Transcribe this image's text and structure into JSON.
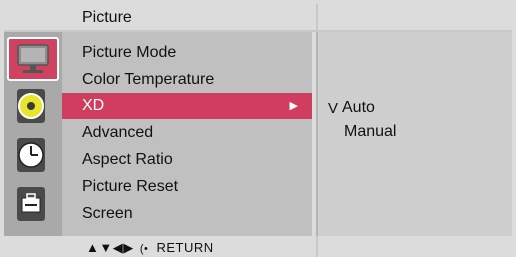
{
  "header": {
    "title": "Picture"
  },
  "sidebar": {
    "icons": [
      {
        "name": "picture-icon",
        "active": true
      },
      {
        "name": "audio-icon",
        "active": false
      },
      {
        "name": "time-icon",
        "active": false
      },
      {
        "name": "option-icon",
        "active": false
      }
    ]
  },
  "menu": {
    "items": [
      {
        "label": "Picture Mode"
      },
      {
        "label": "Color Temperature"
      },
      {
        "label": "XD",
        "selected": true,
        "arrow": "▶"
      },
      {
        "label": "Advanced"
      },
      {
        "label": "Aspect Ratio"
      },
      {
        "label": "Picture Reset"
      },
      {
        "label": "Screen"
      }
    ]
  },
  "submenu": {
    "check_mark": "V",
    "options": [
      "Auto",
      "Manual"
    ],
    "selected": "Auto"
  },
  "footer": {
    "nav_symbols": "▲▼◀▶",
    "enter_symbol": "(•",
    "return_label": "RETURN"
  },
  "colors": {
    "selected": "#cf3e5e",
    "menu_bg": "#c0c0c0"
  }
}
